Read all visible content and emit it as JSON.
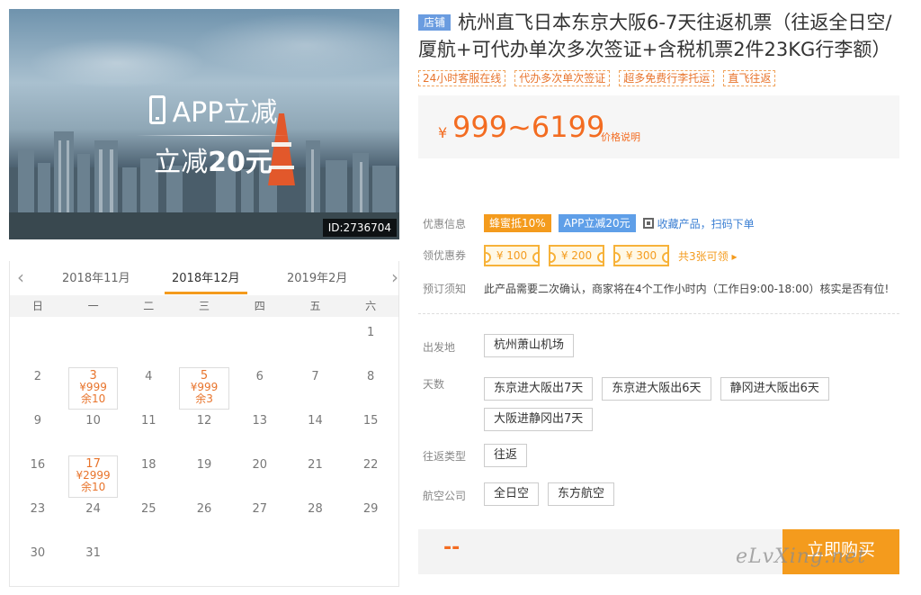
{
  "hero": {
    "promo_line1": "APP立减",
    "promo_line2_prefix": "立减",
    "promo_line2_amount": "20元",
    "id_tag": "ID:2736704"
  },
  "calendar": {
    "prev_month": "2018年11月",
    "current_month": "2018年12月",
    "next_month": "2019年2月",
    "weekdays": [
      "日",
      "一",
      "二",
      "三",
      "四",
      "五",
      "六"
    ],
    "weeks": [
      [
        {
          "d": ""
        },
        {
          "d": ""
        },
        {
          "d": ""
        },
        {
          "d": ""
        },
        {
          "d": ""
        },
        {
          "d": ""
        },
        {
          "d": "1"
        }
      ],
      [
        {
          "d": "2"
        },
        {
          "d": "3",
          "price": "¥999",
          "stock": "余10"
        },
        {
          "d": "4"
        },
        {
          "d": "5",
          "price": "¥999",
          "stock": "余3"
        },
        {
          "d": "6"
        },
        {
          "d": "7"
        },
        {
          "d": "8"
        }
      ],
      [
        {
          "d": "9"
        },
        {
          "d": "10"
        },
        {
          "d": "11"
        },
        {
          "d": "12"
        },
        {
          "d": "13"
        },
        {
          "d": "14"
        },
        {
          "d": "15"
        }
      ],
      [
        {
          "d": "16"
        },
        {
          "d": "17",
          "price": "¥2999",
          "stock": "余10"
        },
        {
          "d": "18"
        },
        {
          "d": "19"
        },
        {
          "d": "20"
        },
        {
          "d": "21"
        },
        {
          "d": "22"
        }
      ],
      [
        {
          "d": "23"
        },
        {
          "d": "24"
        },
        {
          "d": "25"
        },
        {
          "d": "26"
        },
        {
          "d": "27"
        },
        {
          "d": "28"
        },
        {
          "d": "29"
        }
      ],
      [
        {
          "d": "30"
        },
        {
          "d": "31"
        },
        {
          "d": ""
        },
        {
          "d": ""
        },
        {
          "d": ""
        },
        {
          "d": ""
        },
        {
          "d": ""
        }
      ]
    ]
  },
  "product": {
    "shop_badge": "店铺",
    "title": "杭州直飞日本东京大阪6-7天往返机票（往返全日空/厦航+可代办单次多次签证+含税机票2件23KG行李额）",
    "tags": [
      "24小时客服在线",
      "代办多次单次签证",
      "超多免费行李托运",
      "直飞往返"
    ],
    "price_symbol": "¥",
    "price": "999~6199",
    "price_note": "价格说明"
  },
  "offers": {
    "label": "优惠信息",
    "honey": "蜂蜜抵10%",
    "app": "APP立减20元",
    "fav_text": "收藏产品，扫码下单"
  },
  "coupons": {
    "label": "领优惠券",
    "items": [
      "¥ 100",
      "¥ 200",
      "¥ 300"
    ],
    "more": "共3张可领 ▸"
  },
  "booking": {
    "label": "预订须知",
    "text": "此产品需要二次确认，商家将在4个工作小时内（工作日9:00-18:00）核实是否有位!"
  },
  "options": {
    "departure": {
      "label": "出发地",
      "values": [
        "杭州萧山机场"
      ]
    },
    "days": {
      "label": "天数",
      "values": [
        "东京进大阪出7天",
        "东京进大阪出6天",
        "静冈进大阪出6天",
        "大阪进静冈出7天"
      ]
    },
    "trip_type": {
      "label": "往返类型",
      "values": [
        "往返"
      ]
    },
    "airline": {
      "label": "航空公司",
      "values": [
        "全日空",
        "东方航空"
      ]
    }
  },
  "buy": {
    "placeholder_price": "--",
    "button": "立即购买"
  },
  "watermark": "eLvXing.net",
  "colors": {
    "accent": "#f49b1d",
    "price": "#f36c21",
    "blue": "#5f9fe8"
  }
}
